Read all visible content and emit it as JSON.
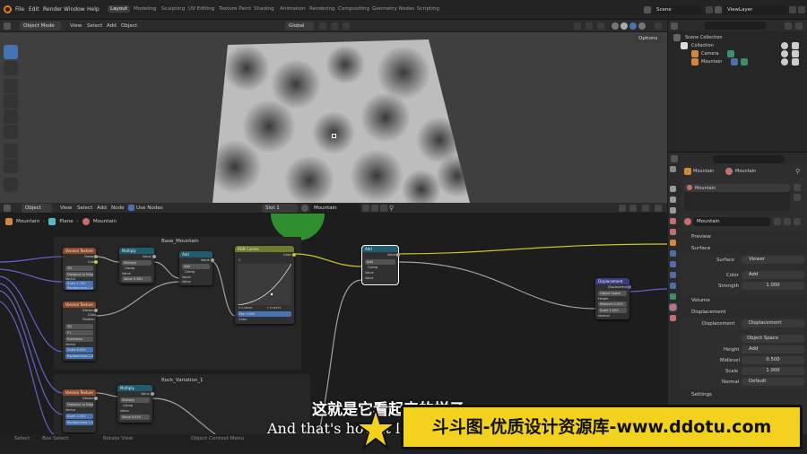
{
  "topbar": {
    "menus": [
      "File",
      "Edit",
      "Render",
      "Window",
      "Help"
    ],
    "workspaces": [
      "Layout",
      "Modeling",
      "Sculpting",
      "UV Editing",
      "Texture Paint",
      "Shading",
      "Animation",
      "Rendering",
      "Compositing",
      "Geometry Nodes",
      "Scripting"
    ],
    "active_workspace": "Layout",
    "scene": "Scene",
    "view_layer": "ViewLayer"
  },
  "viewport_header": {
    "mode": "Object Mode",
    "menus": [
      "View",
      "Select",
      "Add",
      "Object"
    ],
    "transform": "Global",
    "options": "Options"
  },
  "outliner": {
    "scene_collection": "Scene Collection",
    "items": [
      "Collection",
      "Camera",
      "Mountain"
    ]
  },
  "node_header": {
    "type": "Object",
    "menus": [
      "View",
      "Select",
      "Add",
      "Node"
    ],
    "use_nodes": "Use Nodes",
    "slot": "Slot 1",
    "material": "Mountain",
    "breadcrumb": [
      "Mountain",
      "Plane",
      "Mountain"
    ]
  },
  "frames": {
    "base": "Base_Mountain",
    "rock": "Rock_Variation_1"
  },
  "nodes": {
    "noise1": {
      "title": "Voronoi Texture",
      "rows": [
        "Distance",
        "Color",
        "3D",
        "Distance to Edge",
        "Vector",
        "Scale 1.700",
        "Randomness 1.000"
      ]
    },
    "mult1": {
      "title": "Multiply",
      "rows": [
        "Value",
        "Multiply",
        "Clamp",
        "Value",
        "Value 0.360"
      ]
    },
    "add1": {
      "title": "Add",
      "rows": [
        "Value",
        "Add",
        "Clamp",
        "Value",
        "Value"
      ]
    },
    "curves": {
      "title": "RGB Curves",
      "out": "Color",
      "left": "C",
      "fac": "Fac 1.000",
      "color": "Color",
      "tick1": "X 0.38520",
      "tick2": "Y 0.29575"
    },
    "add2": {
      "title": "Add",
      "rows": [
        "Value",
        "Add",
        "Clamp",
        "Value",
        "Value"
      ]
    },
    "noise2": {
      "title": "Voronoi Texture",
      "rows": [
        "Distance",
        "Color",
        "Position",
        "3D",
        "F1",
        "Euclidean",
        "Vector",
        "Scale 6.000",
        "Randomness 1.000"
      ]
    },
    "displacement": {
      "title": "Displacement",
      "rows": [
        "Displacement",
        "Object Space",
        "Height",
        "Midlevel 0.500",
        "Scale 1.000",
        "Normal"
      ]
    },
    "noise3": {
      "title": "Voronoi Texture",
      "rows": [
        "Distance",
        "Distance to Edge",
        "Vector",
        "Scale 2.000",
        "Randomness 1.000"
      ]
    },
    "mult2": {
      "title": "Multiply",
      "rows": [
        "Value",
        "Multiply",
        "Clamp",
        "Value",
        "Value 0.016"
      ]
    }
  },
  "properties": {
    "object": "Mountain",
    "material": "Mountain",
    "slot_name": "Mountain",
    "material_field": "Mountain",
    "sections": {
      "preview": "Preview",
      "surface": "Surface",
      "volume": "Volume",
      "displacement": "Displacement",
      "settings": "Settings"
    },
    "surface_label": "Surface",
    "surface_value": "Viewer",
    "color_label": "Color",
    "color_value": "Add",
    "strength_label": "Strength",
    "strength_value": "1.000",
    "disp_label": "Displacement",
    "disp_value": "Displacement",
    "space_value": "Object Space",
    "height_label": "Height",
    "height_value": "Add",
    "midlevel_label": "Midlevel",
    "midlevel_value": "0.500",
    "scale_label": "Scale",
    "scale_value": "1.000",
    "normal_label": "Normal",
    "normal_value": "Default"
  },
  "status": {
    "items": [
      "Select",
      "Box Select",
      "Rotate View",
      "Object Context Menu"
    ]
  },
  "subtitle": {
    "cn": "这就是它看起来的样子",
    "en": "And that's how it looks"
  },
  "watermark": "斗斗图-优质设计资源库-www.ddotu.com",
  "colors": {
    "accent": "#4772b3",
    "node_tex": "#8a4a28",
    "node_math": "#215c6e",
    "node_curve": "#6e7a2c",
    "node_vec": "#3c3c83",
    "link_yellow": "#c7c729",
    "link_gray": "#a1a1a1",
    "link_purple": "#6363c7",
    "watermark_bg": "#f2d21e"
  }
}
